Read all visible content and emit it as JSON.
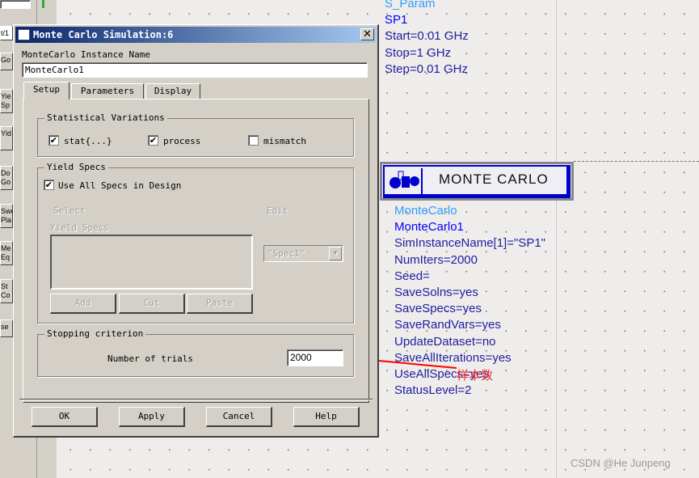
{
  "dialog": {
    "title": "Monte Carlo Simulation:6",
    "instance_label": "MonteCarlo Instance Name",
    "instance_value": "MonteCarlo1",
    "tabs": [
      {
        "label": "Setup",
        "active": true
      },
      {
        "label": "Parameters"
      },
      {
        "label": "Display"
      }
    ],
    "stat_group": "Statistical Variations",
    "checks": [
      {
        "label": "stat{...}",
        "checked": true
      },
      {
        "label": "process",
        "checked": true
      },
      {
        "label": "mismatch",
        "checked": false
      }
    ],
    "yield_group": "Yield Specs",
    "use_all": "Use All Specs in Design",
    "select_label": "Select",
    "edit_label": "Edit",
    "yield_specs_label": "Yield Specs",
    "spec_select": "\"Spec1\"",
    "add": "Add",
    "cut": "Cut",
    "paste": "Paste",
    "stop_group": "Stopping criterion",
    "trials_label": "Number of trials",
    "trials_value": "2000",
    "ok": "OK",
    "apply": "Apply",
    "cancel": "Cancel",
    "help": "Help"
  },
  "leftbar": {
    "items": [
      "t/1",
      "Go",
      "Yie Sp",
      "Yld",
      "Do Go",
      "Swe Pla",
      "Me Eq",
      "St Co",
      "se"
    ]
  },
  "sparam": {
    "lines": [
      "S_Param",
      "SP1",
      "Start=0.01 GHz",
      "Stop=1 GHz",
      "Step=0.01 GHz"
    ]
  },
  "montecarlo": {
    "block_label": "MONTE CARLO",
    "lines": [
      "MonteCarlo",
      "MonteCarlo1",
      "SimInstanceName[1]=\"SP1\"",
      "NumIters=2000",
      "Seed=",
      "SaveSolns=yes",
      "SaveSpecs=yes",
      "SaveRandVars=yes",
      "UpdateDataset=no",
      "SaveAllIterations=yes",
      "UseAllSpecs=yes",
      "StatusLevel=2"
    ]
  },
  "annotation": "样本数",
  "watermark": "CSDN @He Junpeng",
  "colors": {
    "title_start": "#0a246a",
    "title_end": "#a6caf0",
    "component_text": "#2020a0",
    "component_type": "#3399ff",
    "instance": "#0000ff",
    "arrow": "#ff0000"
  }
}
